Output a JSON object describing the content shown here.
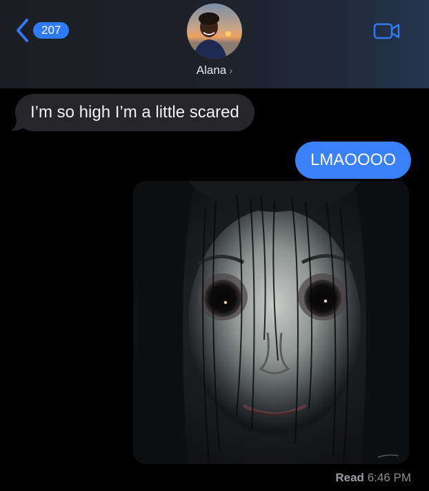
{
  "header": {
    "back_badge_count": "207",
    "contact_name": "Alana",
    "contact_chevron": "›",
    "icons": {
      "back": "chevron-left-icon",
      "video": "video-camera-icon"
    },
    "accent_color": "#2f7af5"
  },
  "messages": [
    {
      "direction": "received",
      "text": "I’m so high I’m a little scared"
    },
    {
      "direction": "sent",
      "text": "LMAOOOO"
    },
    {
      "direction": "sent",
      "type": "image",
      "description_icon": "creepy-face-image"
    }
  ],
  "status": {
    "read_label": "Read",
    "read_time": "6:46 PM"
  },
  "colors": {
    "sent_bubble": "#3a80f6",
    "received_bubble": "#26262a",
    "background": "#000000"
  }
}
